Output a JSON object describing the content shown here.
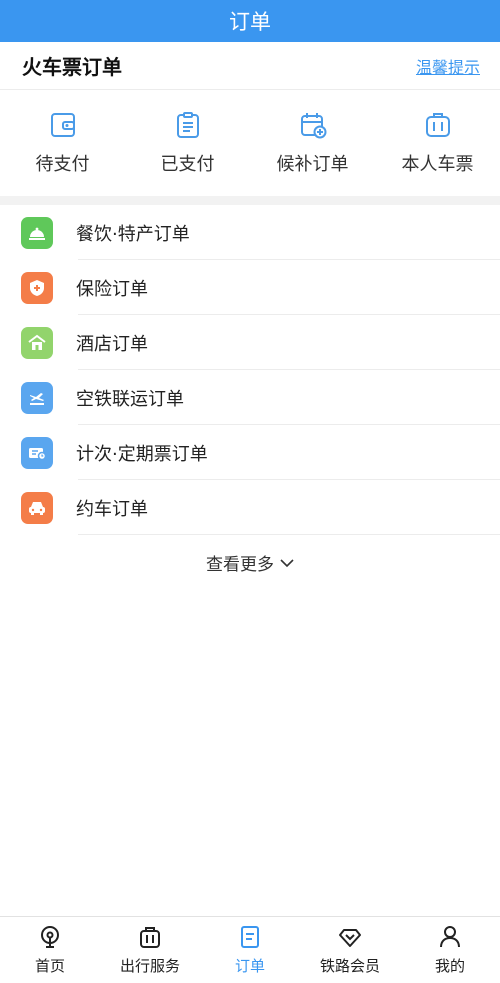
{
  "header": {
    "title": "订单"
  },
  "section": {
    "title": "火车票订单",
    "tip_link": "温馨提示"
  },
  "quick_actions": [
    {
      "label": "待支付",
      "icon": "wallet-icon"
    },
    {
      "label": "已支付",
      "icon": "clipboard-icon"
    },
    {
      "label": "候补订单",
      "icon": "calendar-add-icon"
    },
    {
      "label": "本人车票",
      "icon": "luggage-icon"
    }
  ],
  "orders": [
    {
      "label": "餐饮·特产订单",
      "icon": "food-bell-icon",
      "color": "#5fc85a"
    },
    {
      "label": "保险订单",
      "icon": "shield-icon",
      "color": "#f47d48"
    },
    {
      "label": "酒店订单",
      "icon": "hotel-icon",
      "color": "#92d46c"
    },
    {
      "label": "空铁联运订单",
      "icon": "plane-train-icon",
      "color": "#5aa6ef"
    },
    {
      "label": "计次·定期票订单",
      "icon": "ticket-icon",
      "color": "#5aa6ef"
    },
    {
      "label": "约车订单",
      "icon": "car-icon",
      "color": "#f47d48"
    }
  ],
  "more": {
    "label": "查看更多"
  },
  "bottom_nav": [
    {
      "label": "首页",
      "icon": "home-icon"
    },
    {
      "label": "出行服务",
      "icon": "travel-bag-icon"
    },
    {
      "label": "订单",
      "icon": "order-doc-icon",
      "active": true
    },
    {
      "label": "铁路会员",
      "icon": "diamond-icon"
    },
    {
      "label": "我的",
      "icon": "person-icon"
    }
  ],
  "colors": {
    "accent": "#3a96f0",
    "icon_blue": "#4a9be8"
  }
}
